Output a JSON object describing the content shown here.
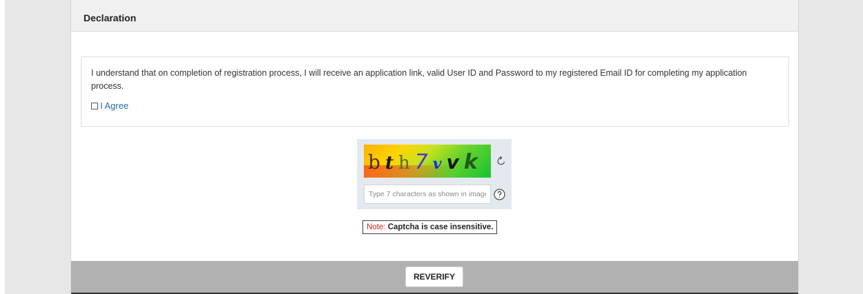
{
  "declaration": {
    "title": "Declaration",
    "text": "I understand that on completion of registration process, I will receive an application link, valid User ID and Password to my registered Email ID for completing my application process.",
    "agree_label": "I Agree",
    "agree_checked": false
  },
  "captcha": {
    "characters": [
      "b",
      "t",
      "h",
      "7",
      "v",
      "v",
      "k"
    ],
    "input_value": "",
    "input_placeholder": "Type 7 characters as shown in image",
    "refresh_icon": "refresh-icon",
    "help_icon": "help-circle-icon"
  },
  "note": {
    "label": "Note:",
    "text": "Captcha is case insensitive."
  },
  "footer": {
    "reverify_label": "REVERIFY"
  },
  "colors": {
    "agree_link": "#1f6aa8",
    "note_label": "#e0201e",
    "footer_bar": "#b1b1b1",
    "page_bg": "#e7e7e7"
  }
}
